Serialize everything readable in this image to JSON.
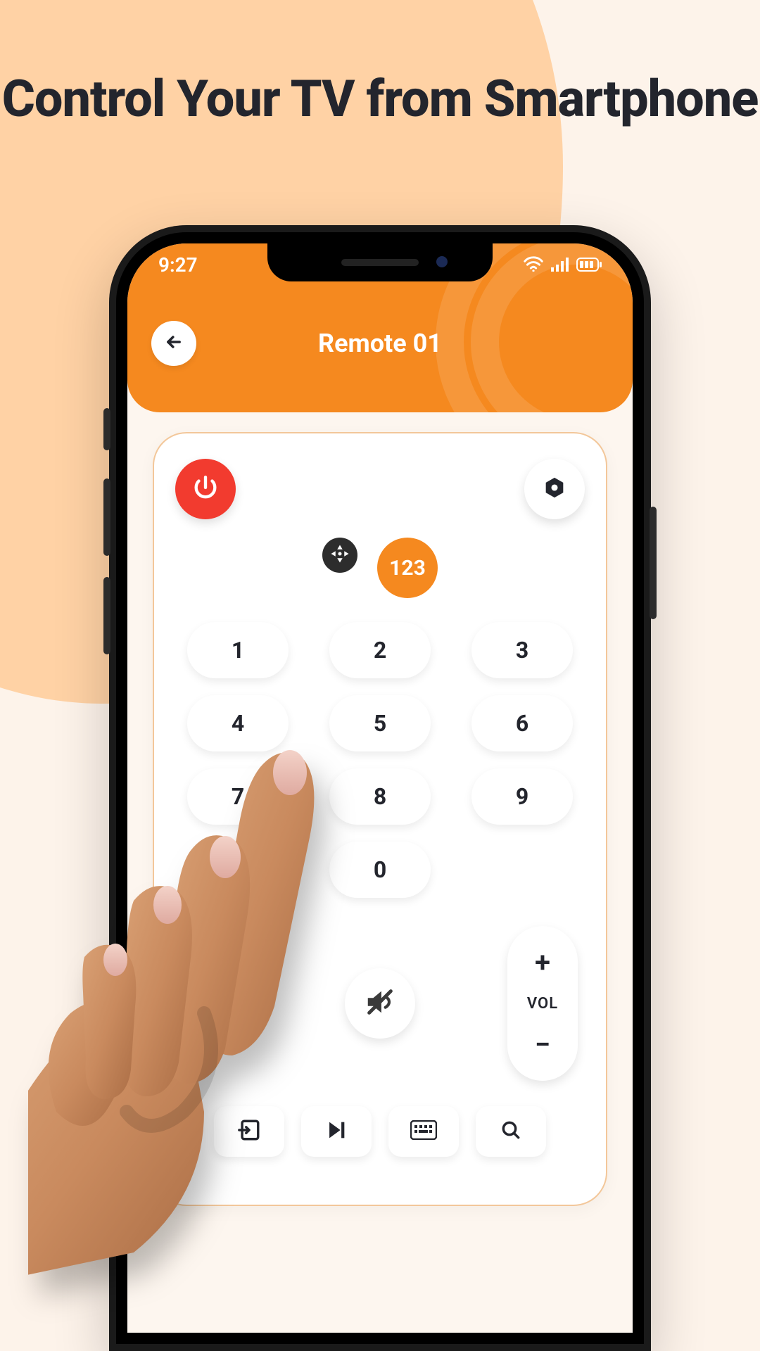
{
  "promo": {
    "headline": "Control Your TV from Smartphone"
  },
  "statusbar": {
    "time": "9:27"
  },
  "header": {
    "title": "Remote 01"
  },
  "mode": {
    "numpad_label": "123"
  },
  "keypad": {
    "keys": [
      "1",
      "2",
      "3",
      "4",
      "5",
      "6",
      "7",
      "8",
      "9",
      "0"
    ]
  },
  "volume": {
    "plus": "+",
    "label": "VOL",
    "minus": "−"
  },
  "colors": {
    "accent": "#f5891f",
    "power": "#f23b2f"
  }
}
